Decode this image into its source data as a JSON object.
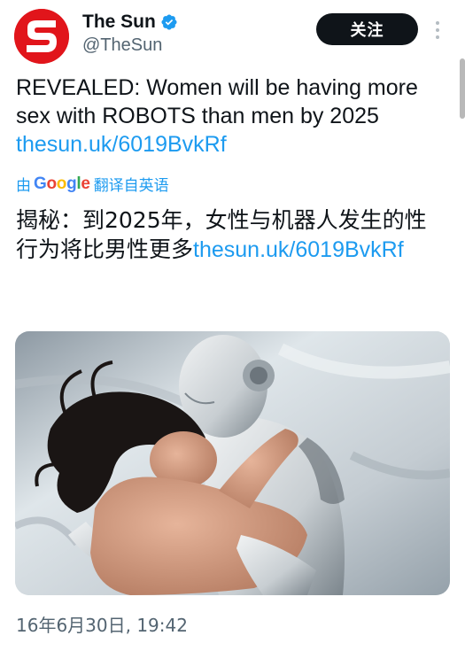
{
  "account": {
    "display_name": "The Sun",
    "handle": "@TheSun",
    "verified": true,
    "avatar_icon": "the-sun-logo",
    "brand_color": "#e1151b"
  },
  "follow_button": {
    "label": "关注"
  },
  "tweet": {
    "text_part1": "REVEALED: Women will be having more sex with ROBOTS than men by 2025",
    "link": "thesun.uk/6019BvkRf",
    "translate_prefix": "由",
    "translate_brand": "Google",
    "translate_suffix": "翻译自英语",
    "translated_text": "揭秘：到2025年，女性与机器人发生的性行为将比男性更多",
    "translated_link": "thesun.uk/6019BvkRf",
    "timestamp": "16年6月30日, 19:42"
  },
  "media": {
    "type": "photo"
  },
  "colors": {
    "link": "#1d9bf0",
    "secondary_text": "#536471",
    "primary_text": "#0f1419"
  }
}
